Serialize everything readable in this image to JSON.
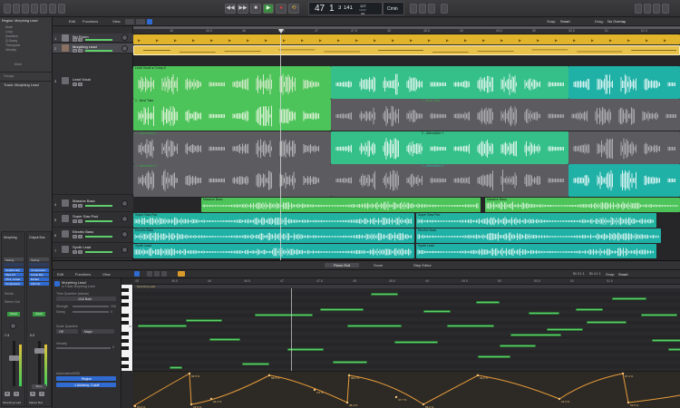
{
  "transport": {
    "bars": "47",
    "beats": "1",
    "sub": "3",
    "ticks": "141",
    "tempo": "127",
    "tempo_sub": "KEEP",
    "key_sig": "4/4",
    "key": "Cmin",
    "counter_label": "BAR BEAT"
  },
  "toolbar": {
    "edit": "Edit",
    "functions": "Functions",
    "view": "View",
    "snap_label": "Snap:",
    "snap_value": "Smart",
    "drag_label": "Drag:",
    "drag_value": "No Overlap"
  },
  "inspector": {
    "region_header": "Region: Morphing Lead",
    "mute": "Mute",
    "loop": "Loop",
    "quantize": "Quantize",
    "q_swing": "Q-Swing",
    "transpose": "Transpose",
    "velocity": "Velocity",
    "more": "More",
    "groups": "Groups",
    "track_header": "Track: Morphing Lead",
    "strip1_name": "Morphing",
    "strip2_name": "Output Bus",
    "setting": "Setting",
    "eq": "EQ",
    "plugins": [
      "Graphic EQ",
      "Tape FX",
      "Chrs, Linear",
      "Compressor"
    ],
    "plugins2": [
      "Compressor",
      "Linear EQ",
      "Exciter",
      "Adt Info"
    ],
    "sends": "Sends",
    "stereo_out": "Stereo Out",
    "read": "Read",
    "vol1": "-7.4",
    "vol2": "0.0",
    "bnce": "Bnce",
    "m": "M",
    "s": "S",
    "bottom1": "Morphing Lead",
    "bottom2": "Master Bus"
  },
  "ruler_marks": [
    "45",
    "45.5",
    "46",
    "46.5",
    "47",
    "47.5",
    "48",
    "48.5",
    "49",
    "49.5",
    "50",
    "50.5",
    "51",
    "51.5",
    "52"
  ],
  "tracks": [
    {
      "num": "1",
      "name": "Big Room"
    },
    {
      "num": "2",
      "name": "Morphing Lead"
    },
    {
      "num": "3",
      "name": "Lead Vocal"
    },
    {
      "num": "4",
      "name": "Massive Bass"
    },
    {
      "num": "5",
      "name": "Super Saw Pad"
    },
    {
      "num": "6",
      "name": "Electric Bass"
    },
    {
      "num": "7",
      "name": "Synth Lead"
    }
  ],
  "regions": {
    "comp": "Lead Vocal ● Comp A",
    "take_a": "1 - Best Take",
    "take_b": "2 - Best Take",
    "alt1a": "1 - Alternative 1",
    "alt1b": "2 - Alternative 1",
    "alt2a": "1 - Alternative 2",
    "alt2b": "2 - Alternative 2",
    "massive_a": "Massive Bass",
    "massive_b": "Massive Bass",
    "superpad_a": "Super Saw Pad",
    "superpad_b": "Super Saw Pad",
    "ebass_a": "Electric Bass",
    "ebass_b": "Electric Bass",
    "synth_a": "Synth Lead",
    "synth_b": "Synth Lead"
  },
  "editor": {
    "tabs": [
      "Piano Roll",
      "Score",
      "Step Editor"
    ],
    "edit": "Edit",
    "functions": "Functions",
    "view": "View",
    "region_name": "Morphing Lead",
    "track_name": "in Track Morphing Lead",
    "time_q": "Time Quantize (classic)",
    "time_q_val": "1/16 Note",
    "strength": "Strength",
    "strength_val": "100",
    "swing": "Swing",
    "swing_val": "0",
    "scale_q": "Scale Quantize",
    "scale_off": "Off",
    "scale_major": "Major",
    "velocity": "Velocity",
    "velocity_val": "0",
    "automation": "Automation/MIDI",
    "region_btn": "Region",
    "auto_param": "1 Alchemy: Cutoff",
    "position": "51 3 1 1",
    "position2": "51 4 1 1",
    "snap_label": "Snap:",
    "snap_val": "Smart",
    "piano_c": "C3",
    "automation_values": [
      "25.6 %",
      "96.5 %",
      "29.6 %",
      "94.2 %",
      "58.5 %",
      "0.5 %",
      "38.4 %",
      "98.2 %",
      "47.7 %",
      "58.2 %",
      "94.5 %",
      "24.3 %",
      "97.4 %",
      "53.5 %"
    ]
  },
  "colors": {
    "yellow": "#e1b42b",
    "green": "#4cc45a",
    "teal": "#1fb0a6",
    "gray_take": "#5c5c60",
    "note_green": "#5fcf6b",
    "automation": "#e89c3a"
  }
}
